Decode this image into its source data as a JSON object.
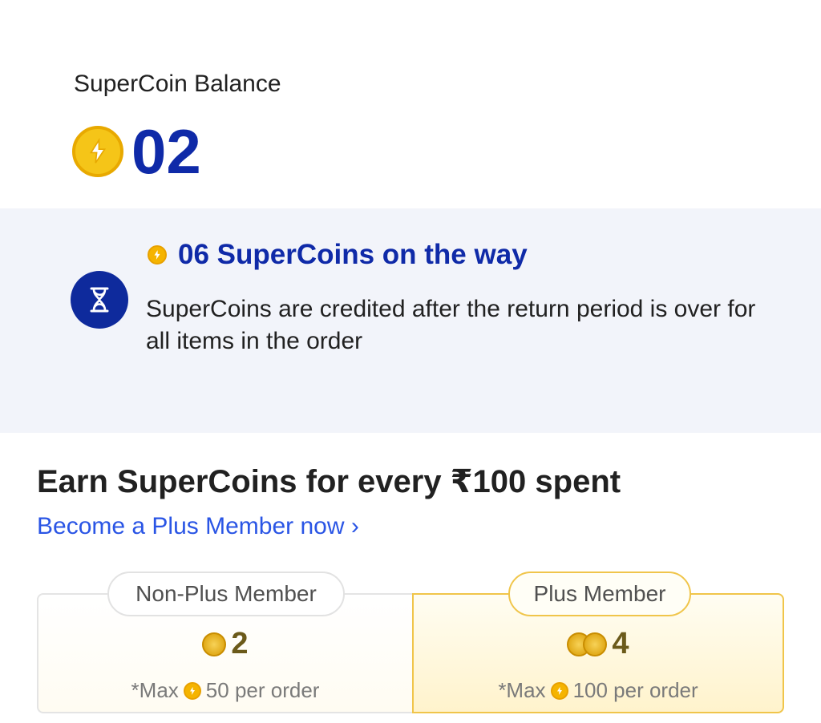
{
  "balance": {
    "label": "SuperCoin Balance",
    "value": "02",
    "coin_icon": "supercoin-icon"
  },
  "pending": {
    "title": "06 SuperCoins on the way",
    "description": "SuperCoins are credited after the return period is over for all items in the order",
    "icon": "hourglass-icon"
  },
  "earn": {
    "title": "Earn SuperCoins for every ₹100 spent",
    "plus_link": "Become a Plus Member now ›",
    "tiers": [
      {
        "name": "Non-Plus Member",
        "rate": "2",
        "max_prefix": "*Max",
        "max_value": "50 per order"
      },
      {
        "name": "Plus Member",
        "rate": "4",
        "max_prefix": "*Max",
        "max_value": "100 per order"
      }
    ]
  },
  "colors": {
    "brand_blue": "#0f2aa8",
    "link_blue": "#2a55e5",
    "coin_gold": "#f5c518",
    "panel_bg": "#f2f4fa"
  }
}
